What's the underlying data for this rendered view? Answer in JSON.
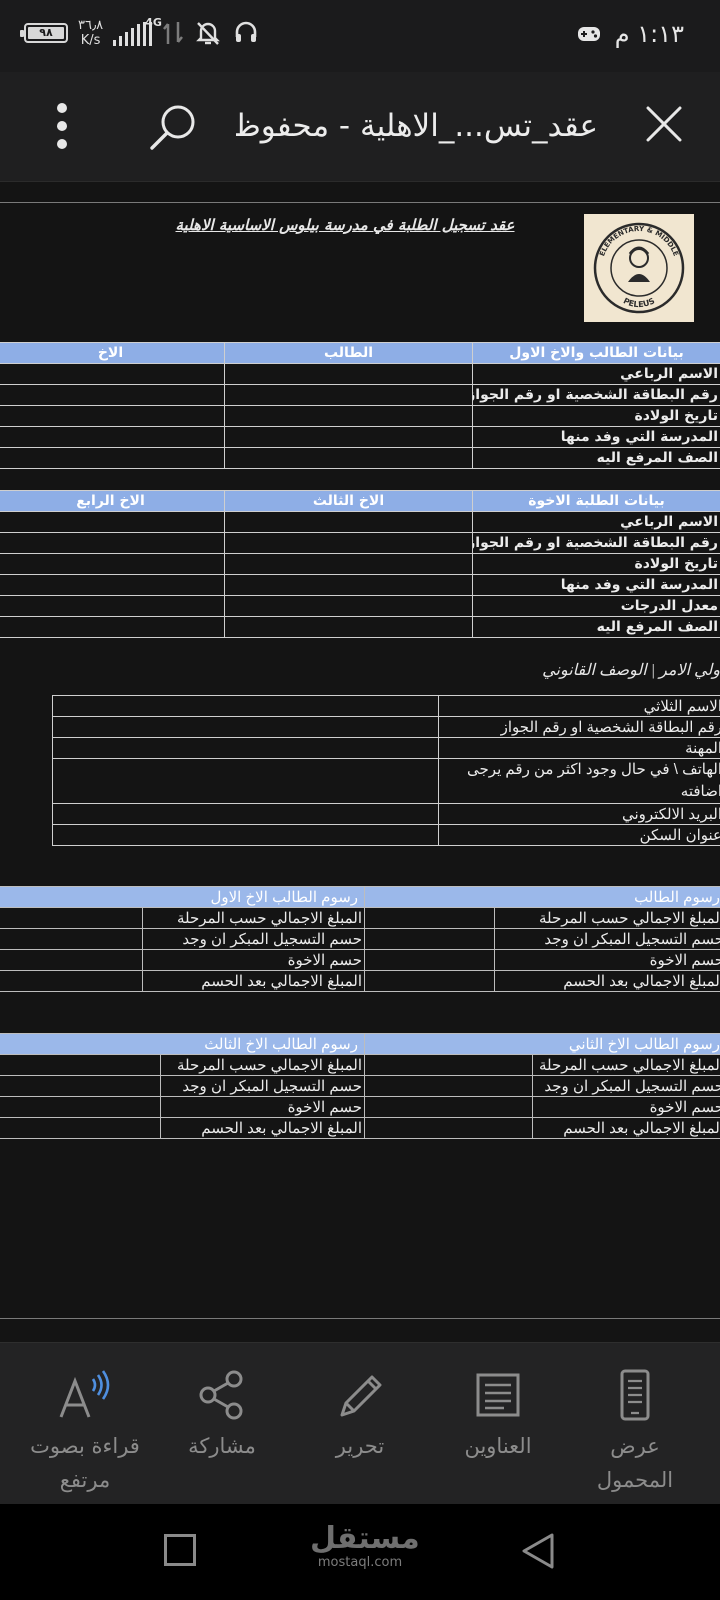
{
  "status": {
    "battery": "٩٨",
    "speed_value": "٣٦٫٨",
    "speed_unit": "K/s",
    "network": "4G",
    "time": "١:١٣ م"
  },
  "title_bar": {
    "title": "عقد_تس..._الاهلية - محفوظ"
  },
  "document": {
    "title": "عقد تسجيل الطلبة في مدرسة بيلوس الاساسية الاهلية",
    "logo": {
      "top_arc": "ELEMENTARY & MIDDLE",
      "bottom_text": "PELEUS"
    },
    "table1": {
      "headers": [
        "بيانات الطالب والاخ الاول",
        "الطالب",
        "الاخ"
      ],
      "rows": [
        "الاسم الرباعي",
        "رقم البطاقة الشخصية او رقم الجواز",
        "تاريخ الولادة",
        "المدرسة التي وفد منها",
        "الصف المرفع اليه"
      ]
    },
    "table2": {
      "headers": [
        "بيانات الطلبة الاخوة",
        "الاخ الثالث",
        "الاخ الرابع"
      ],
      "rows": [
        "الاسم الرباعي",
        "رقم البطاقة الشخصية او رقم الجواز",
        "تاريخ الولادة",
        "المدرسة التي وفد منها",
        "معدل الدرجات",
        "الصف المرفع اليه"
      ]
    },
    "guardian_label": "ولي الامر | الوصف القانوني",
    "guardian_rows": [
      "الاسم الثلاثي",
      "رقم البطاقة الشخصية او رقم الجواز",
      "المهنة",
      "الهاتف \\ في حال وجود اكثر من رقم يرجى اضافته",
      "البريد الالكتروني",
      "عنوان السكن"
    ],
    "fees1": {
      "headers": [
        "رسوم الطالب",
        "رسوم الطالب الاخ الاول"
      ],
      "rows": [
        "المبلغ الاجمالي حسب المرحلة",
        "حسم التسجيل المبكر ان وجد",
        "حسم الاخوة",
        "المبلغ الاجمالي بعد الحسم"
      ]
    },
    "fees2": {
      "headers": [
        "رسوم الطالب الاخ الثاني",
        "رسوم الطالب الاخ الثالث"
      ],
      "rows": [
        "المبلغ الاجمالي حسب المرحلة",
        "حسم التسجيل المبكر ان وجد",
        "حسم الاخوة",
        "المبلغ الاجمالي بعد الحسم"
      ]
    }
  },
  "toolbar": {
    "read_aloud": "قراءة بصوت مرتفع",
    "share": "مشاركة",
    "edit": "تحرير",
    "headings": "العناوين",
    "mobile_view": "عرض المحمول"
  },
  "watermark": {
    "arabic": "مستقل",
    "latin": "mostaql.com"
  },
  "colors": {
    "header_fill": "#8eaee6",
    "background": "#141414",
    "toolbar": "#232324"
  }
}
